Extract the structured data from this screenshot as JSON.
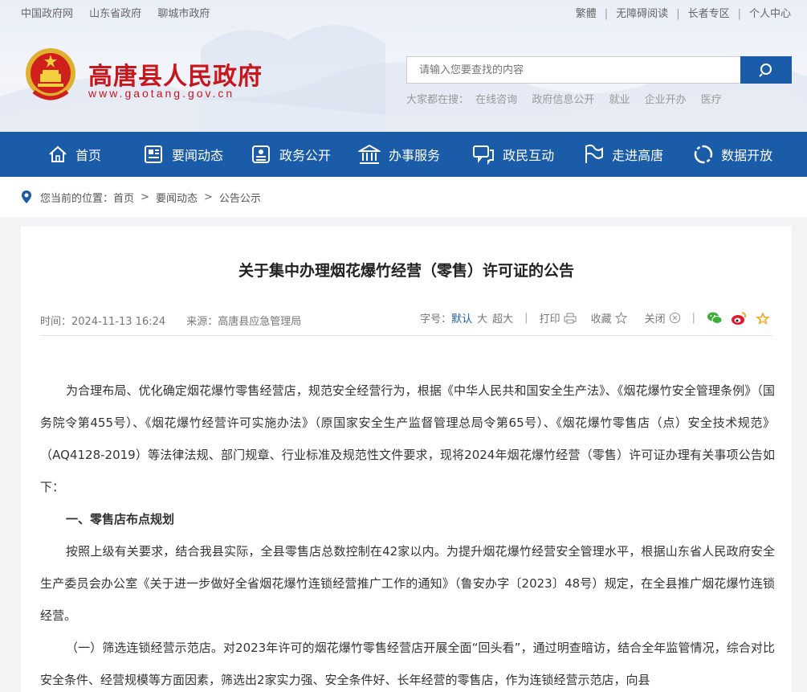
{
  "top_links_left": [
    "中国政府网",
    "山东省政府",
    "聊城市政府"
  ],
  "top_links_right": [
    "繁體",
    "无障碍阅读",
    "长者专区",
    "个人中心"
  ],
  "site": {
    "title": "高唐县人民政府",
    "url": "www.gaotang.gov.cn"
  },
  "search": {
    "placeholder": "请输入您要查找的内容"
  },
  "hot_search": {
    "label": "大家都在搜：",
    "items": [
      "在线咨询",
      "政府信息公开",
      "就业",
      "企业开办",
      "医疗"
    ]
  },
  "nav": [
    {
      "label": "首页",
      "icon": "home-icon"
    },
    {
      "label": "要闻动态",
      "icon": "news-icon"
    },
    {
      "label": "政务公开",
      "icon": "document-icon"
    },
    {
      "label": "办事服务",
      "icon": "building-icon"
    },
    {
      "label": "政民互动",
      "icon": "chat-icon"
    },
    {
      "label": "走进高唐",
      "icon": "flag-icon"
    },
    {
      "label": "数据开放",
      "icon": "data-icon"
    }
  ],
  "breadcrumb": {
    "prefix": "您当前的位置：",
    "items": [
      "首页",
      "要闻动态",
      "公告公示"
    ]
  },
  "article": {
    "title": "关于集中办理烟花爆竹经营（零售）许可证的公告",
    "time": "时间：2024-11-13 16:24",
    "source": "来源：高唐县应急管理局",
    "tools": {
      "font_label": "字号：",
      "font_default": "默认",
      "font_large": "大",
      "font_xlarge": "超大",
      "print": "打印",
      "favorite": "收藏",
      "close": "关闭"
    },
    "paragraphs": [
      "为合理布局、优化确定烟花爆竹零售经营店，规范安全经营行为，根据《中华人民共和国安全生产法》、《烟花爆竹安全管理条例》（国务院令第455号）、《烟花爆竹经营许可实施办法》（原国家安全生产监督管理总局令第65号）、《烟花爆竹零售店（点）安全技术规范》（AQ4128-2019）等法律法规、部门规章、行业标准及规范性文件要求，现将2024年烟花爆竹经营（零售）许可证办理有关事项公告如下：",
      "一、零售店布点规划",
      "按照上级有关要求，结合我县实际，全县零售店总数控制在42家以内。为提升烟花爆竹经营安全管理水平，根据山东省人民政府安全生产委员会办公室《关于进一步做好全省烟花爆竹连锁经营推广工作的通知》（鲁安办字〔2023〕48号）规定，在全县推广烟花爆竹连锁经营。",
      "（一）筛选连锁经营示范店。对2023年许可的烟花爆竹零售经营店开展全面“回头看”，通过明查暗访，结合全年监管情况，综合对比安全条件、经营规模等方面因素，筛选出2家实力强、安全条件好、长年经营的零售店，作为连锁经营示范店，向县"
    ]
  },
  "colors": {
    "brand_blue": "#1a5ca8",
    "title_red": "#c8161d"
  }
}
